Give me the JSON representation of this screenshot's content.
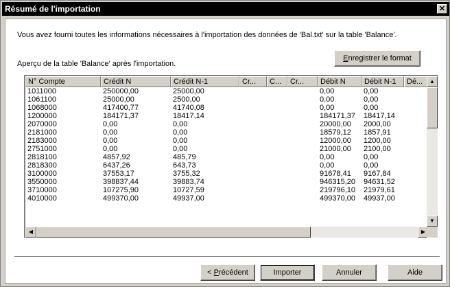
{
  "window": {
    "title": "Résumé de l'importation",
    "close_glyph": "✕"
  },
  "intro_text": "Vous avez fourni toutes les informations nécessaires à l'importation des données de 'Bal.txt' sur la table 'Balance'.",
  "preview_label": "Aperçu de la table 'Balance' après l'importation.",
  "buttons": {
    "save_format": {
      "mnemonic": "E",
      "rest": "nregistrer le format"
    },
    "previous": {
      "prefix": "< ",
      "mnemonic": "P",
      "rest": "récédent"
    },
    "import": "Importer",
    "cancel": "Annuler",
    "help": "Aide"
  },
  "grid": {
    "columns": [
      "N° Compte",
      "Crédit N",
      "Crédit N-1",
      "Cr...",
      "C...",
      "Cr...",
      "Débit N",
      "Débit N-1",
      "Dé..."
    ],
    "rows": [
      [
        "1011000",
        "250000,00",
        "25000,00",
        "",
        "",
        "",
        "0,00",
        "0,00",
        ""
      ],
      [
        "1061100",
        "25000,00",
        "2500,00",
        "",
        "",
        "",
        "0,00",
        "0,00",
        ""
      ],
      [
        "1068000",
        "417400,77",
        "41740,08",
        "",
        "",
        "",
        "0,00",
        "0,00",
        ""
      ],
      [
        "1200000",
        "184171,37",
        "18417,14",
        "",
        "",
        "",
        "184171,37",
        "18417,14",
        ""
      ],
      [
        "2070000",
        "0,00",
        "0,00",
        "",
        "",
        "",
        "20000,00",
        "2000,00",
        ""
      ],
      [
        "2181000",
        "0,00",
        "0,00",
        "",
        "",
        "",
        "18579,12",
        "1857,91",
        ""
      ],
      [
        "2183000",
        "0,00",
        "0,00",
        "",
        "",
        "",
        "12000,00",
        "1200,00",
        ""
      ],
      [
        "2751000",
        "0,00",
        "0,00",
        "",
        "",
        "",
        "21000,00",
        "2100,00",
        ""
      ],
      [
        "2818100",
        "4857,92",
        "485,79",
        "",
        "",
        "",
        "0,00",
        "0,00",
        ""
      ],
      [
        "2818300",
        "6437,26",
        "643,73",
        "",
        "",
        "",
        "0,00",
        "0,00",
        ""
      ],
      [
        "3100000",
        "37553,17",
        "3755,32",
        "",
        "",
        "",
        "91678,41",
        "9167,84",
        ""
      ],
      [
        "3550000",
        "398837,44",
        "39883,74",
        "",
        "",
        "",
        "946315,20",
        "94631,52",
        ""
      ],
      [
        "3710000",
        "107275,90",
        "10727,59",
        "",
        "",
        "",
        "219796,10",
        "21979,61",
        ""
      ],
      [
        "4010000",
        "499370,00",
        "49937,00",
        "",
        "",
        "",
        "499370,00",
        "49937,00",
        ""
      ]
    ]
  },
  "scroll_glyphs": {
    "up": "▲",
    "down": "▼",
    "left": "◀",
    "right": "▶"
  }
}
